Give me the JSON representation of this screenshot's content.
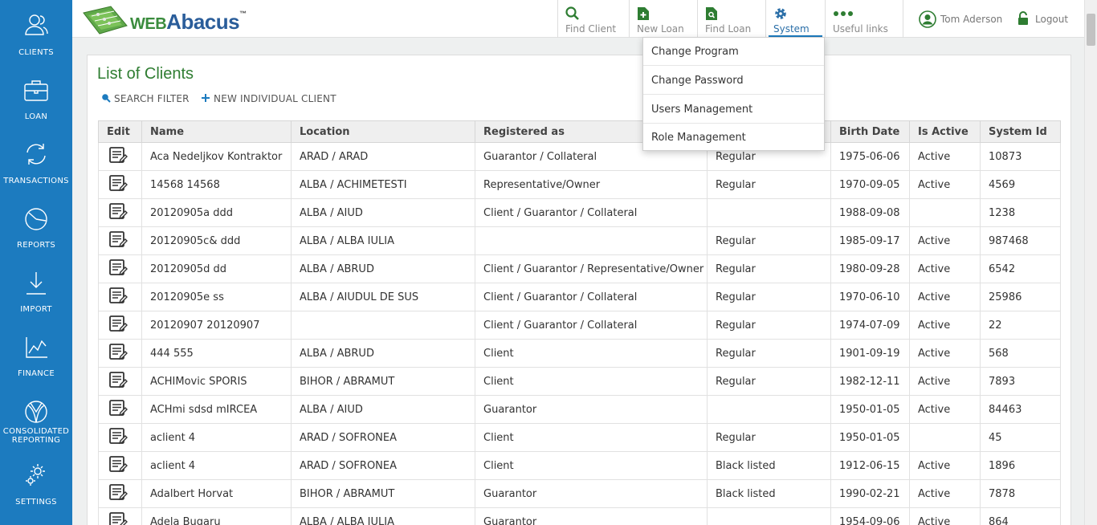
{
  "sidebar": {
    "items": [
      {
        "label": "CLIENTS",
        "icon": "users-icon"
      },
      {
        "label": "LOAN",
        "icon": "briefcase-icon"
      },
      {
        "label": "TRANSACTIONS",
        "icon": "refresh-icon"
      },
      {
        "label": "REPORTS",
        "icon": "pie-chart-icon"
      },
      {
        "label": "IMPORT",
        "icon": "download-icon"
      },
      {
        "label": "FINANCE",
        "icon": "line-chart-icon"
      },
      {
        "label": "CONSOLIDATED",
        "label2": "REPORTING",
        "icon": "consolidated-icon"
      },
      {
        "label": "SETTINGS",
        "icon": "gear-icon"
      }
    ]
  },
  "header": {
    "logo_text_web": "WEB",
    "logo_text_abacus": "Abacus",
    "logo_tm": "™",
    "nav": [
      {
        "label": "Find Client",
        "icon": "search-icon"
      },
      {
        "label": "New Loan",
        "icon": "new-document-icon"
      },
      {
        "label": "Find Loan",
        "icon": "find-document-icon"
      },
      {
        "label": "System",
        "icon": "gear-icon"
      },
      {
        "label": "Useful links",
        "icon": "dots-icon"
      }
    ],
    "user_name": "Tom Aderson",
    "logout_label": "Logout"
  },
  "system_menu": {
    "items": [
      "Change Program",
      "Change Password",
      "Users Management",
      "Role Management"
    ]
  },
  "page": {
    "title": "List of Clients",
    "search_filter": "SEARCH FILTER",
    "new_client": "NEW INDIVIDUAL CLIENT"
  },
  "table": {
    "columns": [
      "Edit",
      "Name",
      "Location",
      "Registered as",
      "",
      "Birth Date",
      "Is Active",
      "System Id"
    ],
    "rows": [
      {
        "name": "Aca Nedeljkov Kontraktor",
        "location": "ARAD / ARAD",
        "registered": "Guarantor / Collateral",
        "status": "Regular",
        "birth": "1975-06-06",
        "active": "Active",
        "id": "10873"
      },
      {
        "name": "14568 14568",
        "location": "ALBA / ACHIMETESTI",
        "registered": "Representative/Owner",
        "status": "Regular",
        "birth": "1970-09-05",
        "active": "Active",
        "id": "4569"
      },
      {
        "name": "20120905a ddd",
        "location": "ALBA / AIUD",
        "registered": "Client / Guarantor / Collateral",
        "status": "",
        "birth": "1988-09-08",
        "active": "",
        "id": "1238"
      },
      {
        "name": "20120905c& ddd",
        "location": "ALBA / ALBA IULIA",
        "registered": "",
        "status": "Regular",
        "birth": "1985-09-17",
        "active": "Active",
        "id": "987468"
      },
      {
        "name": "20120905d dd",
        "location": "ALBA / ABRUD",
        "registered": "Client / Guarantor / Representative/Owner",
        "status": "Regular",
        "birth": "1980-09-28",
        "active": "Active",
        "id": "6542"
      },
      {
        "name": "20120905e ss",
        "location": "ALBA / AIUDUL DE SUS",
        "registered": "Client / Guarantor / Collateral",
        "status": "Regular",
        "birth": "1970-06-10",
        "active": "Active",
        "id": "25986"
      },
      {
        "name": "20120907 20120907",
        "location": "",
        "registered": "Client / Guarantor / Collateral",
        "status": "Regular",
        "birth": "1974-07-09",
        "active": "Active",
        "id": "22"
      },
      {
        "name": "444 555",
        "location": "ALBA / ABRUD",
        "registered": "Client",
        "status": "Regular",
        "birth": "1901-09-19",
        "active": "Active",
        "id": "568"
      },
      {
        "name": "ACHIMovic SPORIS",
        "location": "BIHOR / ABRAMUT",
        "registered": "Client",
        "status": "Regular",
        "birth": "1982-12-11",
        "active": "Active",
        "id": "7893"
      },
      {
        "name": "ACHmi sdsd mIRCEA",
        "location": "ALBA / AIUD",
        "registered": "Guarantor",
        "status": "",
        "birth": "1950-01-05",
        "active": "Active",
        "id": "84463"
      },
      {
        "name": "aclient 4",
        "location": "ARAD / SOFRONEA",
        "registered": "Client",
        "status": "Regular",
        "birth": "1950-01-05",
        "active": "",
        "id": "45"
      },
      {
        "name": "aclient 4",
        "location": "ARAD / SOFRONEA",
        "registered": "Client",
        "status": "Black listed",
        "birth": "1912-06-15",
        "active": "Active",
        "id": "1896"
      },
      {
        "name": " Adalbert Horvat",
        "location": "BIHOR / ABRAMUT",
        "registered": "Guarantor",
        "status": "Black listed",
        "birth": "1990-02-21",
        "active": "Active",
        "id": "7878"
      },
      {
        "name": "Adela Bugaru",
        "location": "ALBA / ALBA IULIA",
        "registered": "Guarantor",
        "status": "",
        "birth": "1954-09-06",
        "active": "Active",
        "id": "864"
      }
    ]
  },
  "colors": {
    "sidebar": "#1c7bbf",
    "title_green": "#2f7d32",
    "nav_icon_green": "#2e7d32",
    "system_icon_blue": "#2b6fa8"
  }
}
